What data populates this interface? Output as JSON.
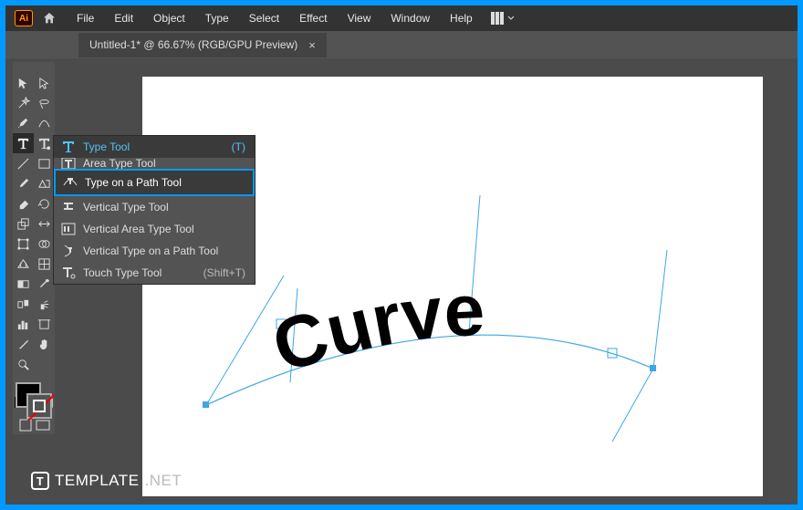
{
  "app": {
    "logo": "Ai"
  },
  "menu": {
    "items": [
      "File",
      "Edit",
      "Object",
      "Type",
      "Select",
      "Effect",
      "View",
      "Window",
      "Help"
    ]
  },
  "tab": {
    "label": "Untitled-1* @ 66.67% (RGB/GPU Preview)",
    "close": "×"
  },
  "flyout": {
    "items": [
      {
        "label": "Type Tool",
        "shortcut": "(T)",
        "selected": true
      },
      {
        "label": "Area Type Tool"
      },
      {
        "label": "Type on a Path Tool",
        "highlight": true
      },
      {
        "label": "Vertical Type Tool"
      },
      {
        "label": "Vertical Area Type Tool"
      },
      {
        "label": "Vertical Type on a Path Tool"
      },
      {
        "label": "Touch Type Tool",
        "shortcut": "(Shift+T)"
      }
    ]
  },
  "canvas": {
    "text": "Curve"
  },
  "watermark": {
    "brand": "TEMPLATE",
    "suffix": ".NET"
  }
}
